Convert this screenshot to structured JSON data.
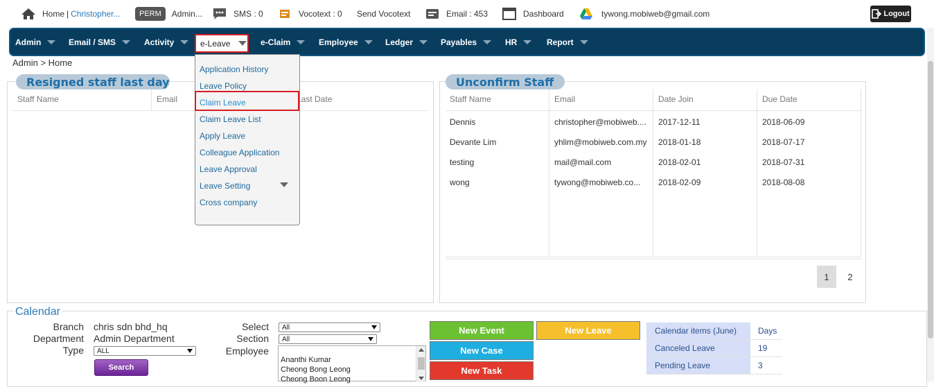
{
  "topbar": {
    "home_label": "Home",
    "user_name": "Christopher...",
    "perm_badge": "PERM",
    "perm_label": "Admin...",
    "sms": "SMS : 0",
    "vocotext": "Vocotext : 0",
    "send_vocotext": "Send Vocotext",
    "email": "Email : 453",
    "dashboard": "Dashboard",
    "account": "tywong.mobiweb@gmail.com",
    "logout": "Logout",
    "separator": "|"
  },
  "nav": {
    "items": [
      "Admin",
      "Email / SMS",
      "Activity",
      "e-Leave",
      "e-Claim",
      "Employee",
      "Ledger",
      "Payables",
      "HR",
      "Report"
    ]
  },
  "dropdown": {
    "items": [
      "Application History",
      "Leave Policy",
      "Claim Leave",
      "Claim Leave List",
      "Apply Leave",
      "Colleague Application",
      "Leave Approval",
      "Leave Setting",
      "Cross company"
    ]
  },
  "breadcrumb": "Admin > Home",
  "resigned": {
    "title": "Resigned staff last day",
    "headers": [
      "Staff Name",
      "Email",
      "Last Date"
    ]
  },
  "unconfirm": {
    "title": "Unconfirm Staff",
    "headers": [
      "Staff Name",
      "Email",
      "Date Join",
      "Due Date"
    ],
    "rows": [
      [
        "Dennis",
        "christopher@mobiweb....",
        "2017-12-11",
        "2018-06-09"
      ],
      [
        "Devante Lim",
        "yhlim@mobiweb.com.my",
        "2018-01-18",
        "2018-07-17"
      ],
      [
        "testing",
        "mail@mail.com",
        "2018-02-01",
        "2018-07-31"
      ],
      [
        "wong",
        "tywong@mobiweb.co...",
        "2018-02-09",
        "2018-08-08"
      ]
    ],
    "pages": [
      "1",
      "2"
    ]
  },
  "calendar": {
    "title": "Calendar",
    "branch_label": "Branch",
    "branch_value": "chris sdn bhd_hq",
    "department_label": "Department",
    "department_value": "Admin Department",
    "type_label": "Type",
    "type_value": "ALL",
    "search_button": "Search",
    "select_label": "Select",
    "select_value": "All",
    "section_label": "Section",
    "section_value": "All",
    "employee_label": "Employee",
    "employees": [
      "Ananthi Kumar",
      "Cheong Bong Leong",
      "Cheong Boon Leong"
    ],
    "buttons": {
      "new_event": "New Event",
      "new_leave": "New Leave",
      "new_case": "New Case",
      "new_task": "New Task"
    },
    "stats": {
      "header_label": "Calendar items (June)",
      "header_value": "Days",
      "rows": [
        {
          "label": "Canceled Leave",
          "value": "19"
        },
        {
          "label": "Pending Leave",
          "value": "3"
        }
      ]
    }
  },
  "colors": {
    "nav_bg": "#083d5e",
    "highlight": "#d81c23",
    "link": "#1f6a9c",
    "new_event": "#6cc133",
    "new_leave": "#f6c02c",
    "new_case": "#1eaee0",
    "new_task": "#e3392c"
  }
}
